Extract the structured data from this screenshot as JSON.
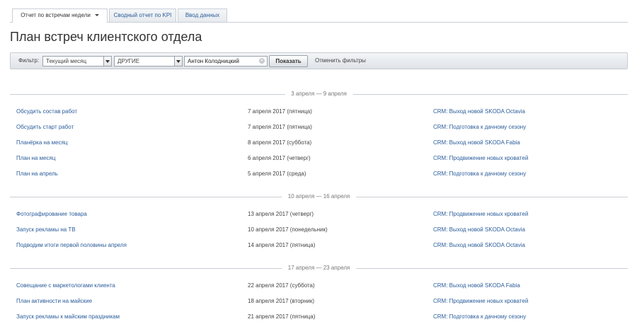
{
  "tabs": [
    {
      "label": "Отчет по встречам недели",
      "active": true
    },
    {
      "label": "Сводный отчет по KPI",
      "active": false
    },
    {
      "label": "Ввод данных",
      "active": false
    }
  ],
  "page_title": "План встреч клиентского отдела",
  "filter": {
    "label": "Фильтр:",
    "period": "Текущий месяц",
    "group": "ДРУГИЕ",
    "person": "Антон Колодницкий",
    "show_label": "Показать",
    "reset_label": "Отменить фильтры"
  },
  "weeks": [
    {
      "label": "3 апреля — 9 апреля",
      "rows": [
        {
          "title": "Обсудить состав работ",
          "date": "7 апреля 2017 (пятница)",
          "crm": "CRM: Выход новой SKODA Octavia"
        },
        {
          "title": "Обсудить старт работ",
          "date": "7 апреля 2017 (пятница)",
          "crm": "CRM: Подготовка к дачному сезону"
        },
        {
          "title": "Планёрка на месяц",
          "date": "8 апреля 2017 (суббота)",
          "crm": "CRM: Выход новой SKODA Fabia"
        },
        {
          "title": "План на месяц",
          "date": "6 апреля 2017 (четверг)",
          "crm": "CRM: Продвижение новых кроватей"
        },
        {
          "title": "План на апрель",
          "date": "5 апреля 2017 (среда)",
          "crm": "CRM: Подготовка к дачному сезону"
        }
      ]
    },
    {
      "label": "10 апреля — 16 апреля",
      "rows": [
        {
          "title": "Фотографирование товара",
          "date": "13 апреля 2017 (четверг)",
          "crm": "CRM: Продвижение новых кроватей"
        },
        {
          "title": "Запуск рекламы на ТВ",
          "date": "10 апреля 2017 (понедельник)",
          "crm": "CRM: Выход новой SKODA Octavia"
        },
        {
          "title": "Подводим итоги первой половины апреля",
          "date": "14 апреля 2017 (пятница)",
          "crm": "CRM: Выход новой SKODA Octavia"
        }
      ]
    },
    {
      "label": "17 апреля — 23 апреля",
      "rows": [
        {
          "title": "Совещание с маркетологами клиента",
          "date": "22 апреля 2017 (суббота)",
          "crm": "CRM: Выход новой SKODA Fabia"
        },
        {
          "title": "План активности на майские",
          "date": "18 апреля 2017 (вторник)",
          "crm": "CRM: Продвижение новых кроватей"
        },
        {
          "title": "Запуск рекламы к майским праздникам",
          "date": "21 апреля 2017 (пятница)",
          "crm": "CRM: Подготовка к дачному сезону"
        }
      ]
    }
  ]
}
